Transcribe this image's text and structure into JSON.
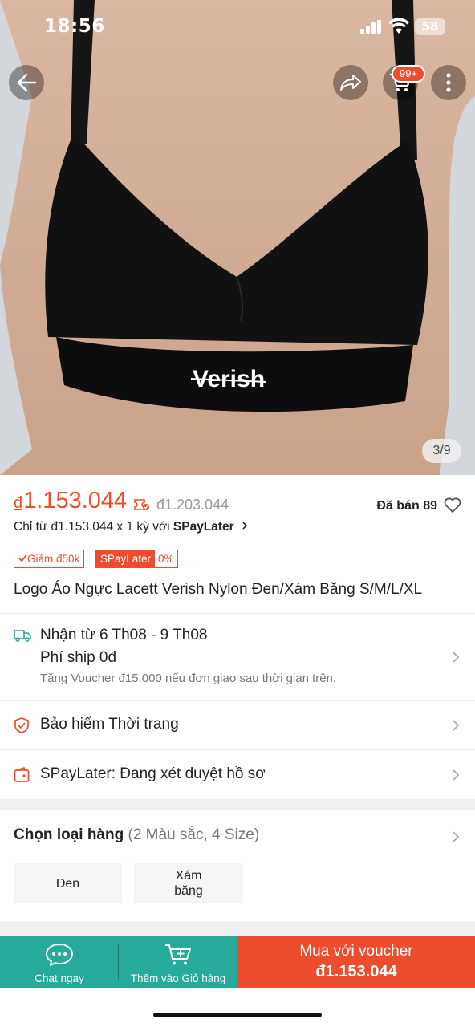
{
  "status_bar": {
    "time": "18:56",
    "battery": "58"
  },
  "header": {
    "cart_badge": "99+"
  },
  "gallery": {
    "counter": "3/9",
    "brand_text": "Verish"
  },
  "price": {
    "currency": "đ",
    "current": "1.153.044",
    "original": "đ1.203.044",
    "sold": "Đã bán 89"
  },
  "spaylater": {
    "prefix": "Chỉ từ đ1.153.044 x 1 kỳ với ",
    "brand": "SPayLater"
  },
  "badges": {
    "discount": "Giảm đ50k",
    "spay_label": "SPayLater",
    "spay_rate": "0%"
  },
  "product": {
    "title": "Logo Áo Ngực Lacett Verish Nylon Đen/Xám Băng S/M/L/XL"
  },
  "shipping": {
    "line1": "Nhận từ 6 Th08 - 9 Th08",
    "line2": "Phí ship 0đ",
    "note": "Tặng Voucher đ15.000 nếu đơn giao sau thời gian trên."
  },
  "insurance": {
    "label": "Bảo hiểm Thời trang"
  },
  "spay_status": {
    "label": "SPayLater: Đang xét duyệt hồ sơ"
  },
  "variants": {
    "title": "Chọn loại hàng",
    "subtitle": "(2 Màu sắc, 4 Size)",
    "options": [
      "Đen",
      "Xám băng"
    ]
  },
  "bottom_bar": {
    "chat_label": "Chat ngay",
    "add_cart_label": "Thêm vào Giỏ hàng",
    "buy_line1": "Mua với voucher",
    "buy_line2": "đ1.153.044"
  },
  "colors": {
    "accent": "#ee4d2d",
    "teal": "#26aa99"
  }
}
